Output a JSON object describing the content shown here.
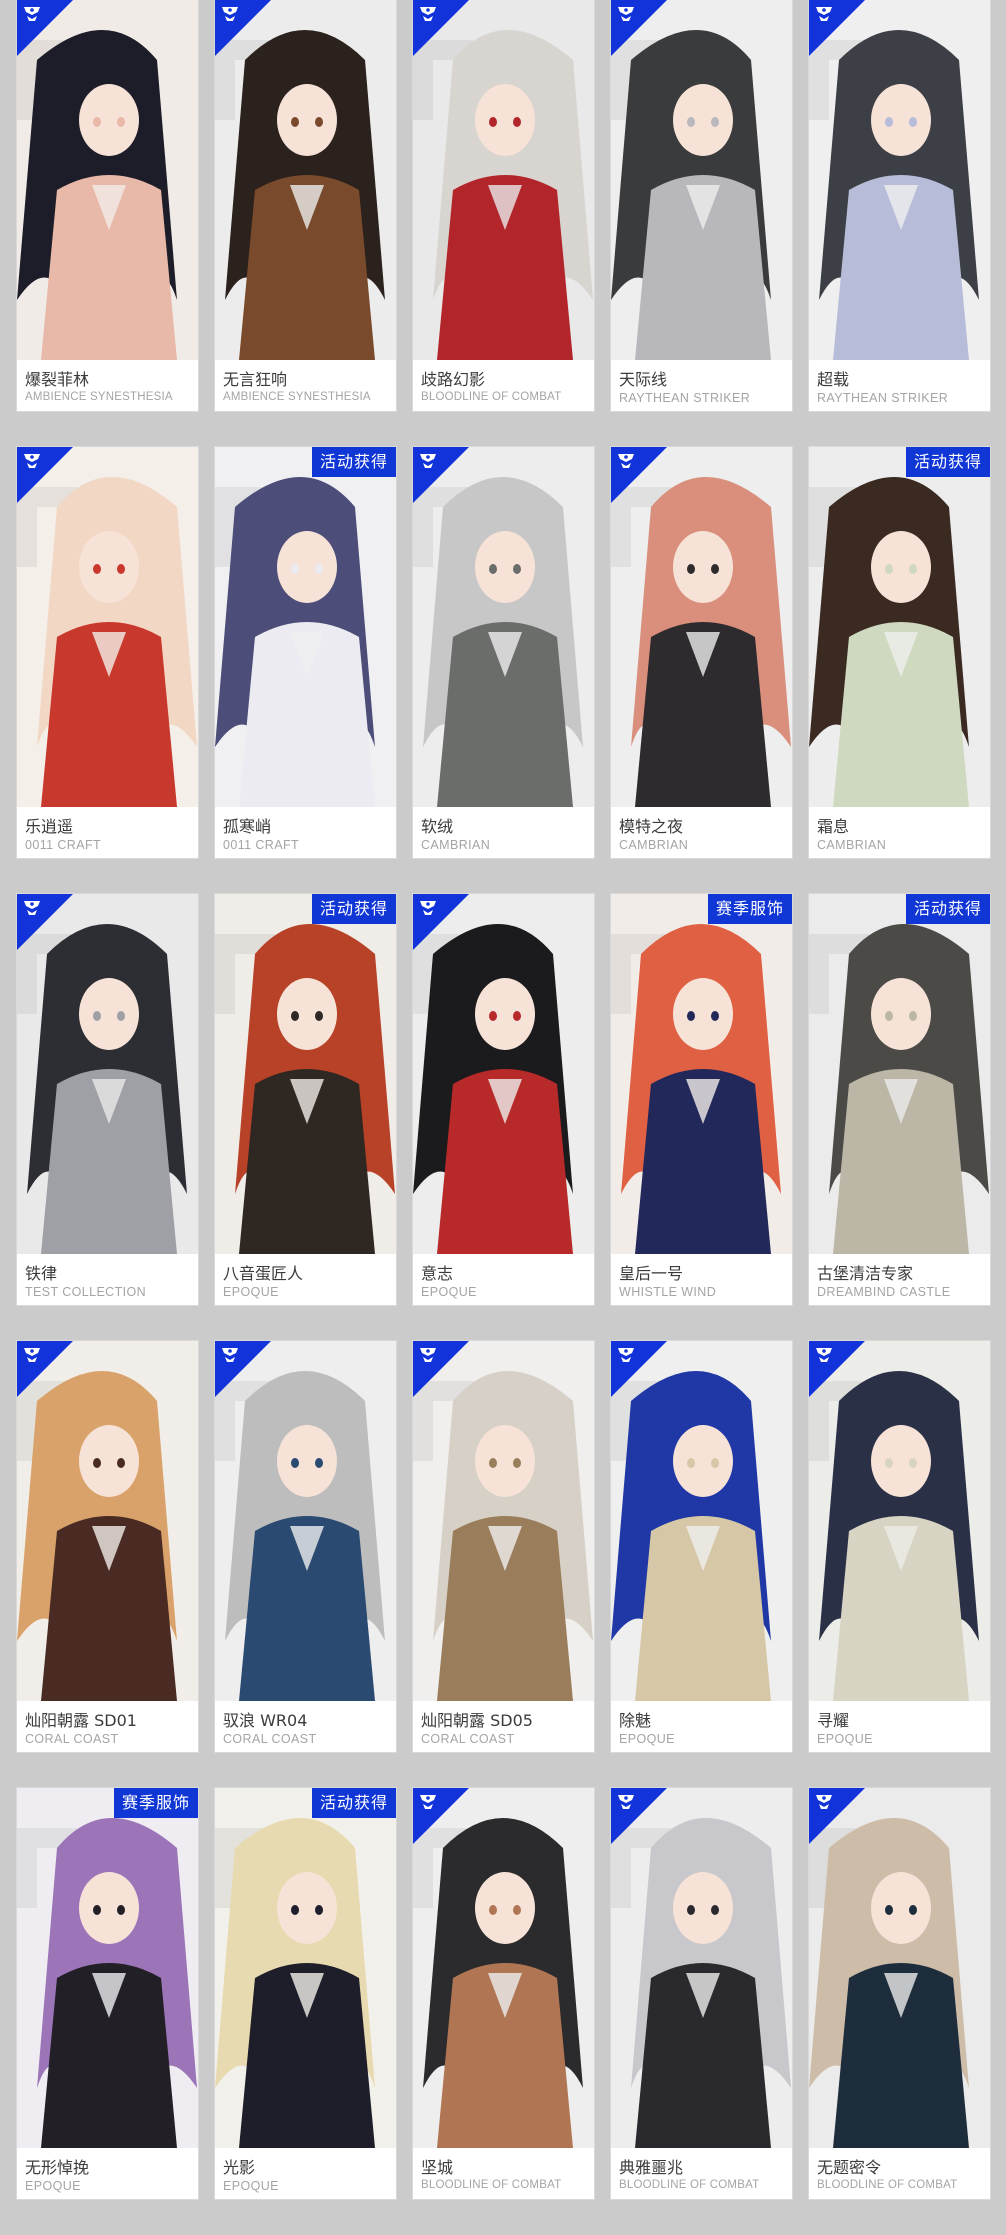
{
  "tags": {
    "event": "活动获得",
    "season": "赛季服饰"
  },
  "colors": {
    "accent_blue": "#1233d9",
    "background": "#cbcbcb",
    "card": "#ffffff"
  },
  "cards": [
    {
      "name": "爆裂菲林",
      "series": "AMBIENCE SYNESTHESIA",
      "tag": "",
      "icon": "shop-crest-icon",
      "palette": [
        "#f1ebe7",
        "#1d1d29",
        "#e8b8a8"
      ]
    },
    {
      "name": "无言狂响",
      "series": "AMBIENCE SYNESTHESIA",
      "tag": "",
      "icon": "shop-crest-icon",
      "palette": [
        "#ececec",
        "#2b221d",
        "#7a4a2c"
      ]
    },
    {
      "name": "歧路幻影",
      "series": "BLOODLINE OF COMBAT",
      "tag": "",
      "icon": "shop-crest-icon",
      "palette": [
        "#e9e9e9",
        "#d8d4cf",
        "#b2262b"
      ]
    },
    {
      "name": "天际线",
      "series": "RAYTHEAN STRIKER",
      "tag": "",
      "icon": "shop-crest-icon",
      "palette": [
        "#eeeeee",
        "#3a3b3d",
        "#b8b8bc"
      ]
    },
    {
      "name": "超载",
      "series": "RAYTHEAN STRIKER",
      "tag": "",
      "icon": "shop-crest-icon",
      "palette": [
        "#efefef",
        "#3d3f46",
        "#b7bdd8"
      ]
    },
    {
      "name": "乐逍遥",
      "series": "0011 CRAFT",
      "tag": "",
      "icon": "shop-crest-icon",
      "palette": [
        "#f4efe9",
        "#f2d7c5",
        "#c9382d"
      ]
    },
    {
      "name": "孤寒峭",
      "series": "0011 CRAFT",
      "tag": "event",
      "icon": "",
      "palette": [
        "#f0f0f3",
        "#4c4d78",
        "#ebebf1"
      ]
    },
    {
      "name": "软绒",
      "series": "CAMBRIAN",
      "tag": "",
      "icon": "shop-crest-icon",
      "palette": [
        "#ededed",
        "#c7c7c7",
        "#6b6d6a"
      ]
    },
    {
      "name": "模特之夜",
      "series": "CAMBRIAN",
      "tag": "",
      "icon": "shop-crest-icon",
      "palette": [
        "#eeeeee",
        "#d98f7c",
        "#2e2b2f"
      ]
    },
    {
      "name": "霜息",
      "series": "CAMBRIAN",
      "tag": "event",
      "icon": "",
      "palette": [
        "#ededed",
        "#3b2a22",
        "#cfd9bf"
      ]
    },
    {
      "name": "铁律",
      "series": "TEST COLLECTION",
      "tag": "",
      "icon": "shop-crest-icon",
      "palette": [
        "#e9e9e9",
        "#2c2e33",
        "#9ea0a6"
      ]
    },
    {
      "name": "八音蛋匠人",
      "series": "EPOQUE",
      "tag": "event",
      "icon": "",
      "palette": [
        "#f0ece7",
        "#b84228",
        "#2f2722"
      ]
    },
    {
      "name": "意志",
      "series": "EPOQUE",
      "tag": "",
      "icon": "shop-crest-icon",
      "palette": [
        "#ededed",
        "#1b1a1d",
        "#b82a2a"
      ]
    },
    {
      "name": "皇后一号",
      "series": "WHISTLE WIND",
      "tag": "season",
      "icon": "",
      "palette": [
        "#f2ece8",
        "#e06044",
        "#22285a"
      ]
    },
    {
      "name": "古堡清洁专家",
      "series": "DREAMBIND CASTLE",
      "tag": "event",
      "icon": "",
      "palette": [
        "#ebebeb",
        "#4b4a47",
        "#bcb6a6"
      ]
    },
    {
      "name": "灿阳朝露 SD01",
      "series": "CORAL COAST",
      "tag": "",
      "icon": "shop-crest-icon",
      "palette": [
        "#f1eee9",
        "#d8a26a",
        "#4a2b23"
      ]
    },
    {
      "name": "驭浪 WR04",
      "series": "CORAL COAST",
      "tag": "",
      "icon": "shop-crest-icon",
      "palette": [
        "#eeeeee",
        "#bdbdbd",
        "#2a4a72"
      ]
    },
    {
      "name": "灿阳朝露 SD05",
      "series": "CORAL COAST",
      "tag": "",
      "icon": "shop-crest-icon",
      "palette": [
        "#f0efed",
        "#d6d0c7",
        "#9a7e5c"
      ]
    },
    {
      "name": "除魅",
      "series": "EPOQUE",
      "tag": "",
      "icon": "shop-crest-icon",
      "palette": [
        "#efefef",
        "#1f38a6",
        "#d6c8a6"
      ]
    },
    {
      "name": "寻耀",
      "series": "EPOQUE",
      "tag": "",
      "icon": "shop-crest-icon",
      "palette": [
        "#ecece9",
        "#2a3045",
        "#d8d4c4"
      ]
    },
    {
      "name": "无形悼挽",
      "series": "EPOQUE",
      "tag": "season",
      "icon": "",
      "palette": [
        "#efedf1",
        "#9c74b8",
        "#222026"
      ]
    },
    {
      "name": "光影",
      "series": "EPOQUE",
      "tag": "event",
      "icon": "",
      "palette": [
        "#f2f0ea",
        "#e8dab0",
        "#1d1e2a"
      ]
    },
    {
      "name": "坚城",
      "series": "BLOODLINE OF COMBAT",
      "tag": "",
      "icon": "shop-crest-icon",
      "palette": [
        "#eeeeee",
        "#2b2a2d",
        "#b07654"
      ]
    },
    {
      "name": "典雅噩兆",
      "series": "BLOODLINE OF COMBAT",
      "tag": "",
      "icon": "shop-crest-icon",
      "palette": [
        "#ededed",
        "#c7c7cc",
        "#2a2a2e"
      ]
    },
    {
      "name": "无题密令",
      "series": "BLOODLINE OF COMBAT",
      "tag": "",
      "icon": "shop-crest-icon",
      "palette": [
        "#ebebeb",
        "#cdbda8",
        "#1e2d3b"
      ]
    }
  ]
}
